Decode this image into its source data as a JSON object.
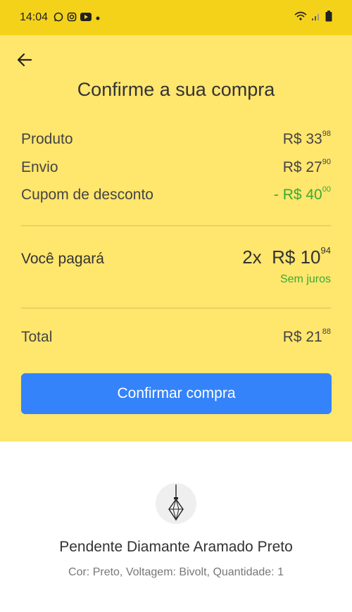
{
  "status_bar": {
    "time": "14:04",
    "notification_icons": [
      "whatsapp-icon",
      "instagram-icon",
      "youtube-icon",
      "dot-icon"
    ],
    "system_icons": [
      "wifi-icon",
      "signal-icon",
      "battery-icon"
    ]
  },
  "header": {
    "back_icon": "arrow-left-icon",
    "title": "Confirme a sua compra"
  },
  "summary": {
    "product": {
      "label": "Produto",
      "currency": "R$ 33",
      "cents": "98"
    },
    "shipping": {
      "label": "Envio",
      "currency": "R$ 27",
      "cents": "90"
    },
    "coupon": {
      "label": "Cupom de desconto",
      "currency": "- R$ 40",
      "cents": "00"
    }
  },
  "payment": {
    "label": "Você pagará",
    "installments": "2x",
    "currency": "R$ 10",
    "cents": "94",
    "note": "Sem juros"
  },
  "total": {
    "label": "Total",
    "currency": "R$ 21",
    "cents": "88"
  },
  "confirm_button": "Confirmar compra",
  "product": {
    "image_icon": "pendant-lamp-icon",
    "name": "Pendente Diamante Aramado Preto",
    "details": "Cor: Preto, Voltagem: Bivolt, Quantidade: 1"
  },
  "colors": {
    "status_bar": "#f5d21a",
    "header_bg": "#ffe66d",
    "button": "#3483fa",
    "green": "#3aaa35"
  }
}
